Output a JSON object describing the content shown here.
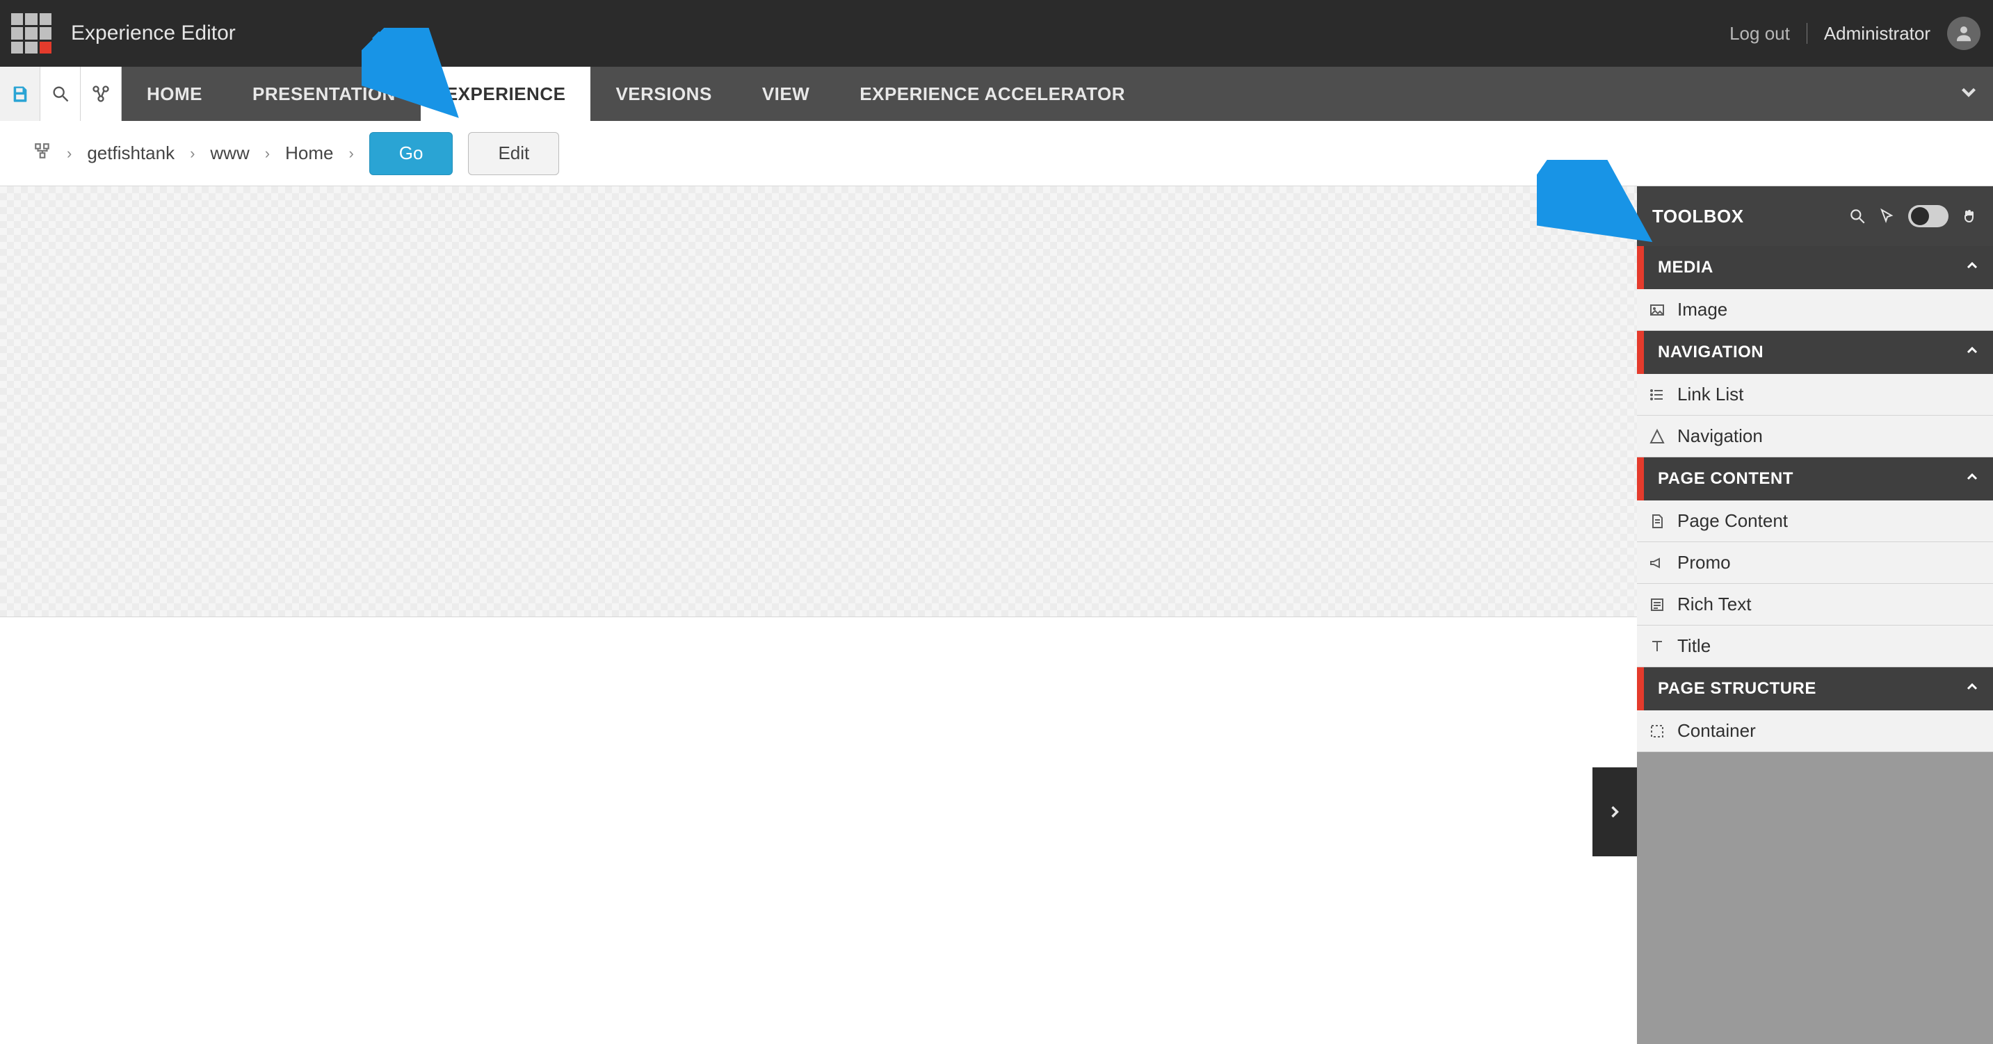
{
  "app_title": "Experience Editor",
  "topbar": {
    "logout_label": "Log out",
    "username": "Administrator"
  },
  "ribbon": {
    "tabs": [
      {
        "id": "home",
        "label": "HOME"
      },
      {
        "id": "presentation",
        "label": "PRESENTATION"
      },
      {
        "id": "experience",
        "label": "EXPERIENCE"
      },
      {
        "id": "versions",
        "label": "VERSIONS"
      },
      {
        "id": "view",
        "label": "VIEW"
      },
      {
        "id": "experience_accelerator",
        "label": "EXPERIENCE ACCELERATOR"
      }
    ],
    "active_tab": "experience"
  },
  "breadcrumb": {
    "items": [
      "getfishtank",
      "www",
      "Home"
    ],
    "go_label": "Go",
    "edit_label": "Edit"
  },
  "toolbox": {
    "title": "TOOLBOX",
    "sections": [
      {
        "title": "MEDIA",
        "items": [
          {
            "icon": "image",
            "label": "Image"
          }
        ]
      },
      {
        "title": "NAVIGATION",
        "items": [
          {
            "icon": "list",
            "label": "Link List"
          },
          {
            "icon": "nav",
            "label": "Navigation"
          }
        ]
      },
      {
        "title": "PAGE CONTENT",
        "items": [
          {
            "icon": "page",
            "label": "Page Content"
          },
          {
            "icon": "megaphone",
            "label": "Promo"
          },
          {
            "icon": "richtext",
            "label": "Rich Text"
          },
          {
            "icon": "title",
            "label": "Title"
          }
        ]
      },
      {
        "title": "PAGE STRUCTURE",
        "items": [
          {
            "icon": "container",
            "label": "Container"
          }
        ]
      }
    ]
  }
}
